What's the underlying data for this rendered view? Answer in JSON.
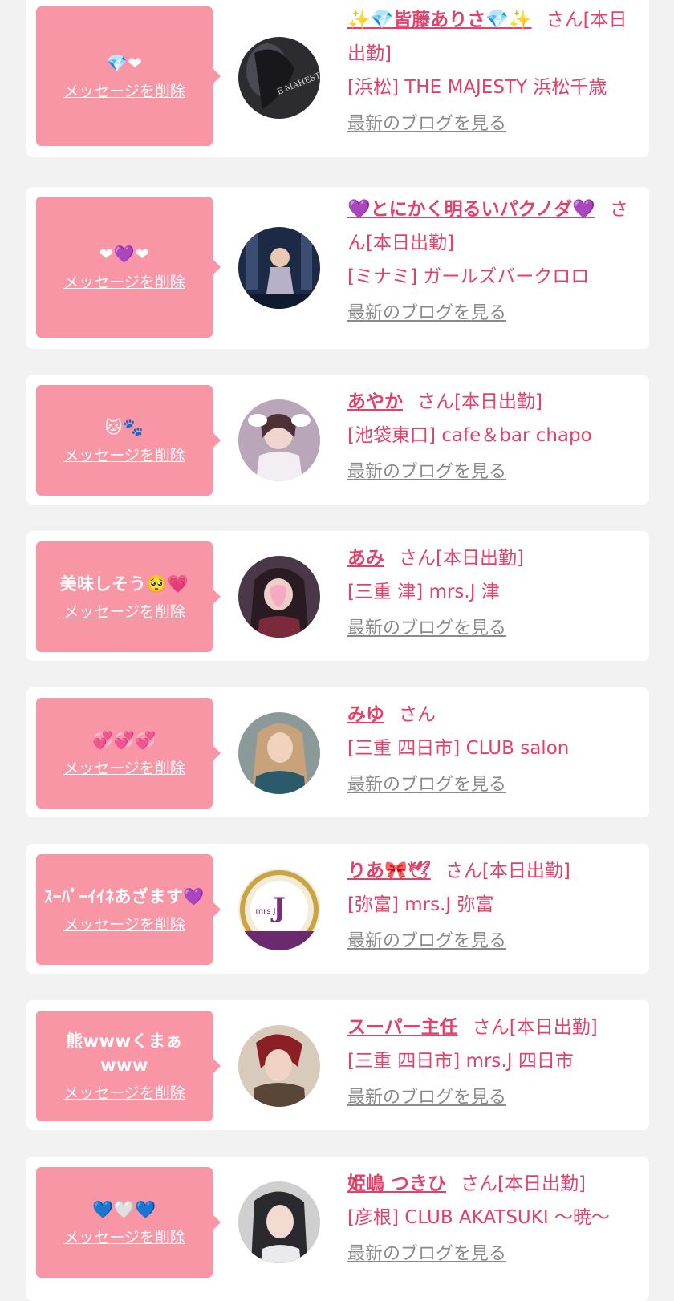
{
  "delete_label": "メッセージを削除",
  "blog_label": "最新のブログを見る",
  "colors": {
    "accent": "#e0426c",
    "bubble": "#f996a6",
    "background": "#f2f2f2",
    "card": "#ffffff",
    "muted": "#8a8a8a"
  },
  "cards": [
    {
      "message": "💎❤",
      "name": "✨💎皆藤ありさ💎✨",
      "suffix": "さん[本日出勤]",
      "shop": "[浜松] THE MAJESTY 浜松千歳",
      "avatar_label": "E MAHESTY"
    },
    {
      "message": "❤💜❤",
      "name": "💜とにかく明るいパクノダ💜",
      "suffix": "さん[本日出勤]",
      "shop": "[ミナミ] ガールズバークロロ",
      "avatar_label": ""
    },
    {
      "message": "🐱🐾",
      "name": "あやか",
      "suffix": "さん[本日出勤]",
      "shop": "[池袋東口] cafe＆bar chapo",
      "avatar_label": ""
    },
    {
      "message": "美味しそう🥺💗",
      "name": "あみ",
      "suffix": "さん[本日出勤]",
      "shop": "[三重 津] mrs.J 津",
      "avatar_label": ""
    },
    {
      "message": "💞💞💞",
      "name": "みゆ",
      "suffix": "さん",
      "shop": "[三重 四日市] CLUB salon",
      "avatar_label": ""
    },
    {
      "message": "ｽｰﾊﾟｰｲｲﾈあざます💜",
      "name": "りあ🎀🕊",
      "suffix": "さん[本日出勤]",
      "shop": "[弥富] mrs.J 弥富",
      "avatar_label": "mrs J"
    },
    {
      "message": "熊wwwくまぁwww",
      "name": "スーパー主任",
      "suffix": "さん[本日出勤]",
      "shop": "[三重 四日市] mrs.J 四日市",
      "avatar_label": ""
    },
    {
      "message": "💙🤍💙",
      "name": "姫嶋 つきひ",
      "suffix": "さん[本日出勤]",
      "shop": "[彦根] CLUB AKATSUKI 〜暁〜",
      "avatar_label": ""
    }
  ]
}
